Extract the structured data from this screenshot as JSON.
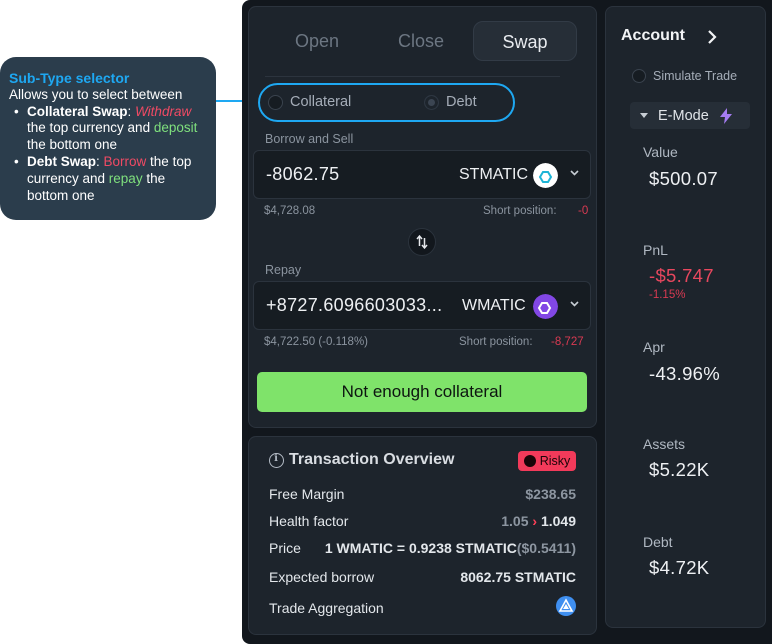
{
  "callout": {
    "title": "Sub-Type selector",
    "intro": "Allows you to select between",
    "items": [
      {
        "label": "Collateral Swap",
        "sep": ": ",
        "verb1": "Withdraw",
        "mid": " the top currency and ",
        "verb2": "deposit",
        "end": " the bottom one"
      },
      {
        "label": "Debt Swap",
        "sep": ": ",
        "verb1": "Borrow",
        "mid": " the top currency and ",
        "verb2": "repay",
        "end": " the bottom one"
      }
    ]
  },
  "tabs": [
    "Open",
    "Close",
    "Swap"
  ],
  "active_tab": "Swap",
  "subtype": {
    "options": [
      "Collateral",
      "Debt"
    ],
    "selected": "Debt"
  },
  "top": {
    "label": "Borrow and Sell",
    "amount": "-8062.75",
    "token": "STMATIC",
    "usd": "$4,728.08",
    "short_label": "Short position:",
    "short_value": "-0"
  },
  "bottom": {
    "label": "Repay",
    "amount": "+8727.6096603033...",
    "token": "WMATIC",
    "usd": "$4,722.50 (-0.118%)",
    "short_label": "Short position:",
    "short_value": "-8,727"
  },
  "cta": "Not enough collateral",
  "overview": {
    "title": "Transaction Overview",
    "badge": "Risky",
    "free_margin_label": "Free Margin",
    "free_margin": "$238.65",
    "health_label": "Health factor",
    "health_from": "1.05",
    "health_arrow": "›",
    "health_to": "1.049",
    "price_label": "Price",
    "price_value": "1 WMATIC = 0.9238 STMATIC",
    "price_usd": "($0.5411)",
    "borrow_label": "Expected borrow",
    "borrow_value": "8062.75 STMATIC",
    "aggregation_label": "Trade Aggregation"
  },
  "account": {
    "title": "Account",
    "simulate": "Simulate Trade",
    "emode": "E-Mode",
    "value_label": "Value",
    "value": "$500.07",
    "pnl_label": "PnL",
    "pnl": "-$5.747",
    "pnl_pct": "-1.15%",
    "apr_label": "Apr",
    "apr": "-43.96%",
    "assets_label": "Assets",
    "assets": "$5.22K",
    "debt_label": "Debt",
    "debt": "$4.72K"
  },
  "colors": {
    "accent": "#1ea8f2",
    "cta": "#7fe36a",
    "danger": "#f23a5a",
    "stmatic": "#ffffff",
    "wmatic": "#8247e5"
  }
}
